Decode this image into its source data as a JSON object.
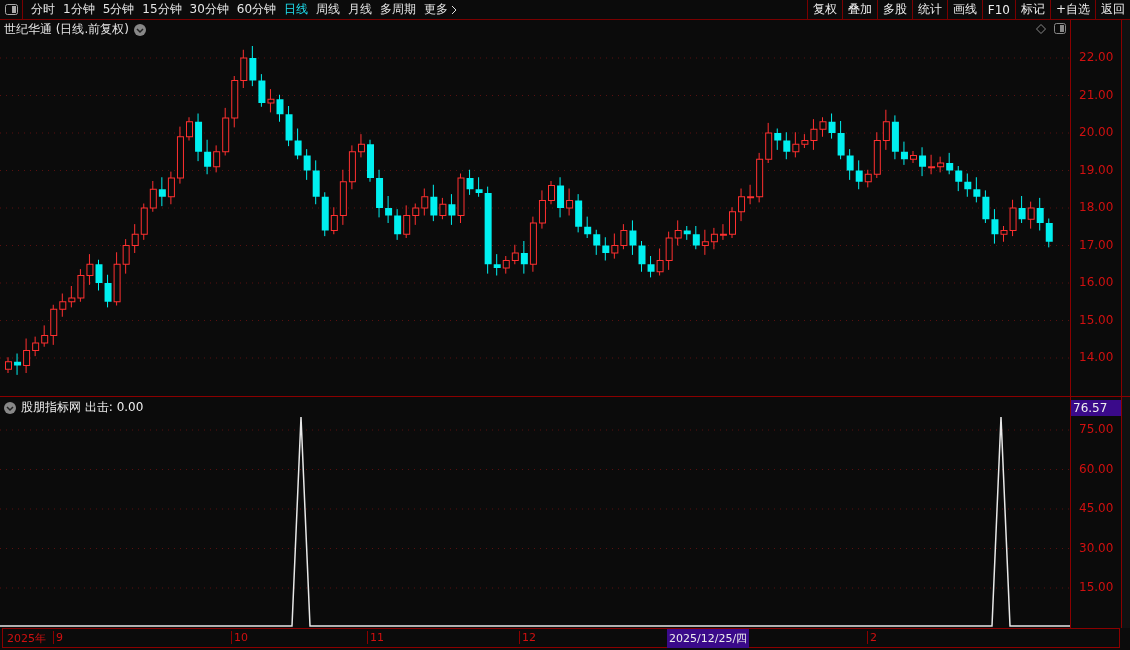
{
  "toolbar": {
    "periods": [
      {
        "label": "分时",
        "selected": false
      },
      {
        "label": "1分钟",
        "selected": false
      },
      {
        "label": "5分钟",
        "selected": false
      },
      {
        "label": "15分钟",
        "selected": false
      },
      {
        "label": "30分钟",
        "selected": false
      },
      {
        "label": "60分钟",
        "selected": false
      },
      {
        "label": "日线",
        "selected": true
      },
      {
        "label": "周线",
        "selected": false
      },
      {
        "label": "月线",
        "selected": false
      },
      {
        "label": "多周期",
        "selected": false
      }
    ],
    "more": "更多",
    "actions": [
      "复权",
      "叠加",
      "多股",
      "统计",
      "画线",
      "F10",
      "标记",
      "+自选",
      "返回"
    ]
  },
  "price_chart": {
    "title": "世纪华通 (日线.前复权)",
    "y_ticks": [
      "22.00",
      "21.00",
      "20.00",
      "19.00",
      "18.00",
      "17.00",
      "16.00",
      "15.00",
      "14.00"
    ]
  },
  "indicator": {
    "title": "股朋指标网 出击: 0.00",
    "current_value": "76.57",
    "y_ticks": [
      "75.00",
      "60.00",
      "45.00",
      "30.00",
      "15.00"
    ]
  },
  "date_axis": {
    "labels": [
      {
        "text": "2025年",
        "kind": "year"
      },
      {
        "text": "9",
        "kind": "month"
      },
      {
        "text": "10",
        "kind": "month"
      },
      {
        "text": "11",
        "kind": "month"
      },
      {
        "text": "12",
        "kind": "month"
      },
      {
        "text": "2025/12/25/四",
        "kind": "cursor"
      },
      {
        "text": "2",
        "kind": "month"
      }
    ]
  }
}
